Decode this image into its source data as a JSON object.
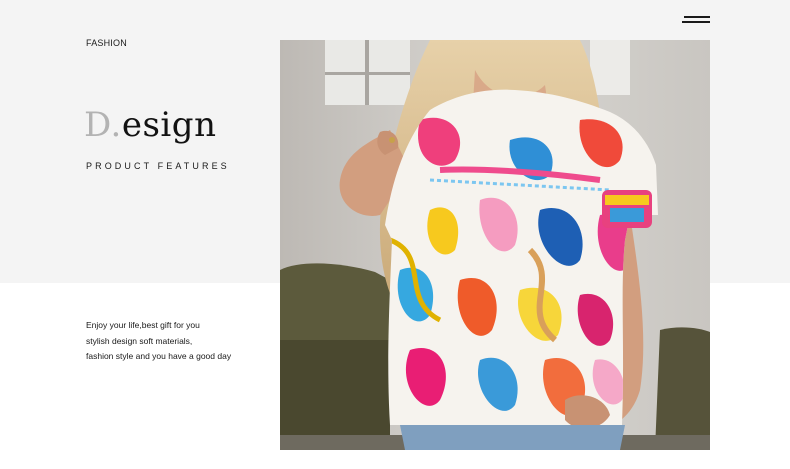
{
  "header": {
    "eyebrow": "FASHION",
    "menu_icon": "hamburger-menu-icon"
  },
  "hero": {
    "title_initial": "D.",
    "title_rest": "esign",
    "subtitle": "PRODUCT FEATURES"
  },
  "description": {
    "lines": [
      "Enjoy your life,best gift for you",
      "stylish design soft materials,",
      "fashion style and you have a good day"
    ]
  },
  "colors": {
    "top_band": "#f4f4f4",
    "accent_initial": "#b3b3b3",
    "text": "#121212"
  },
  "photo": {
    "subject": "model-wearing-colorful-print-blouse"
  }
}
